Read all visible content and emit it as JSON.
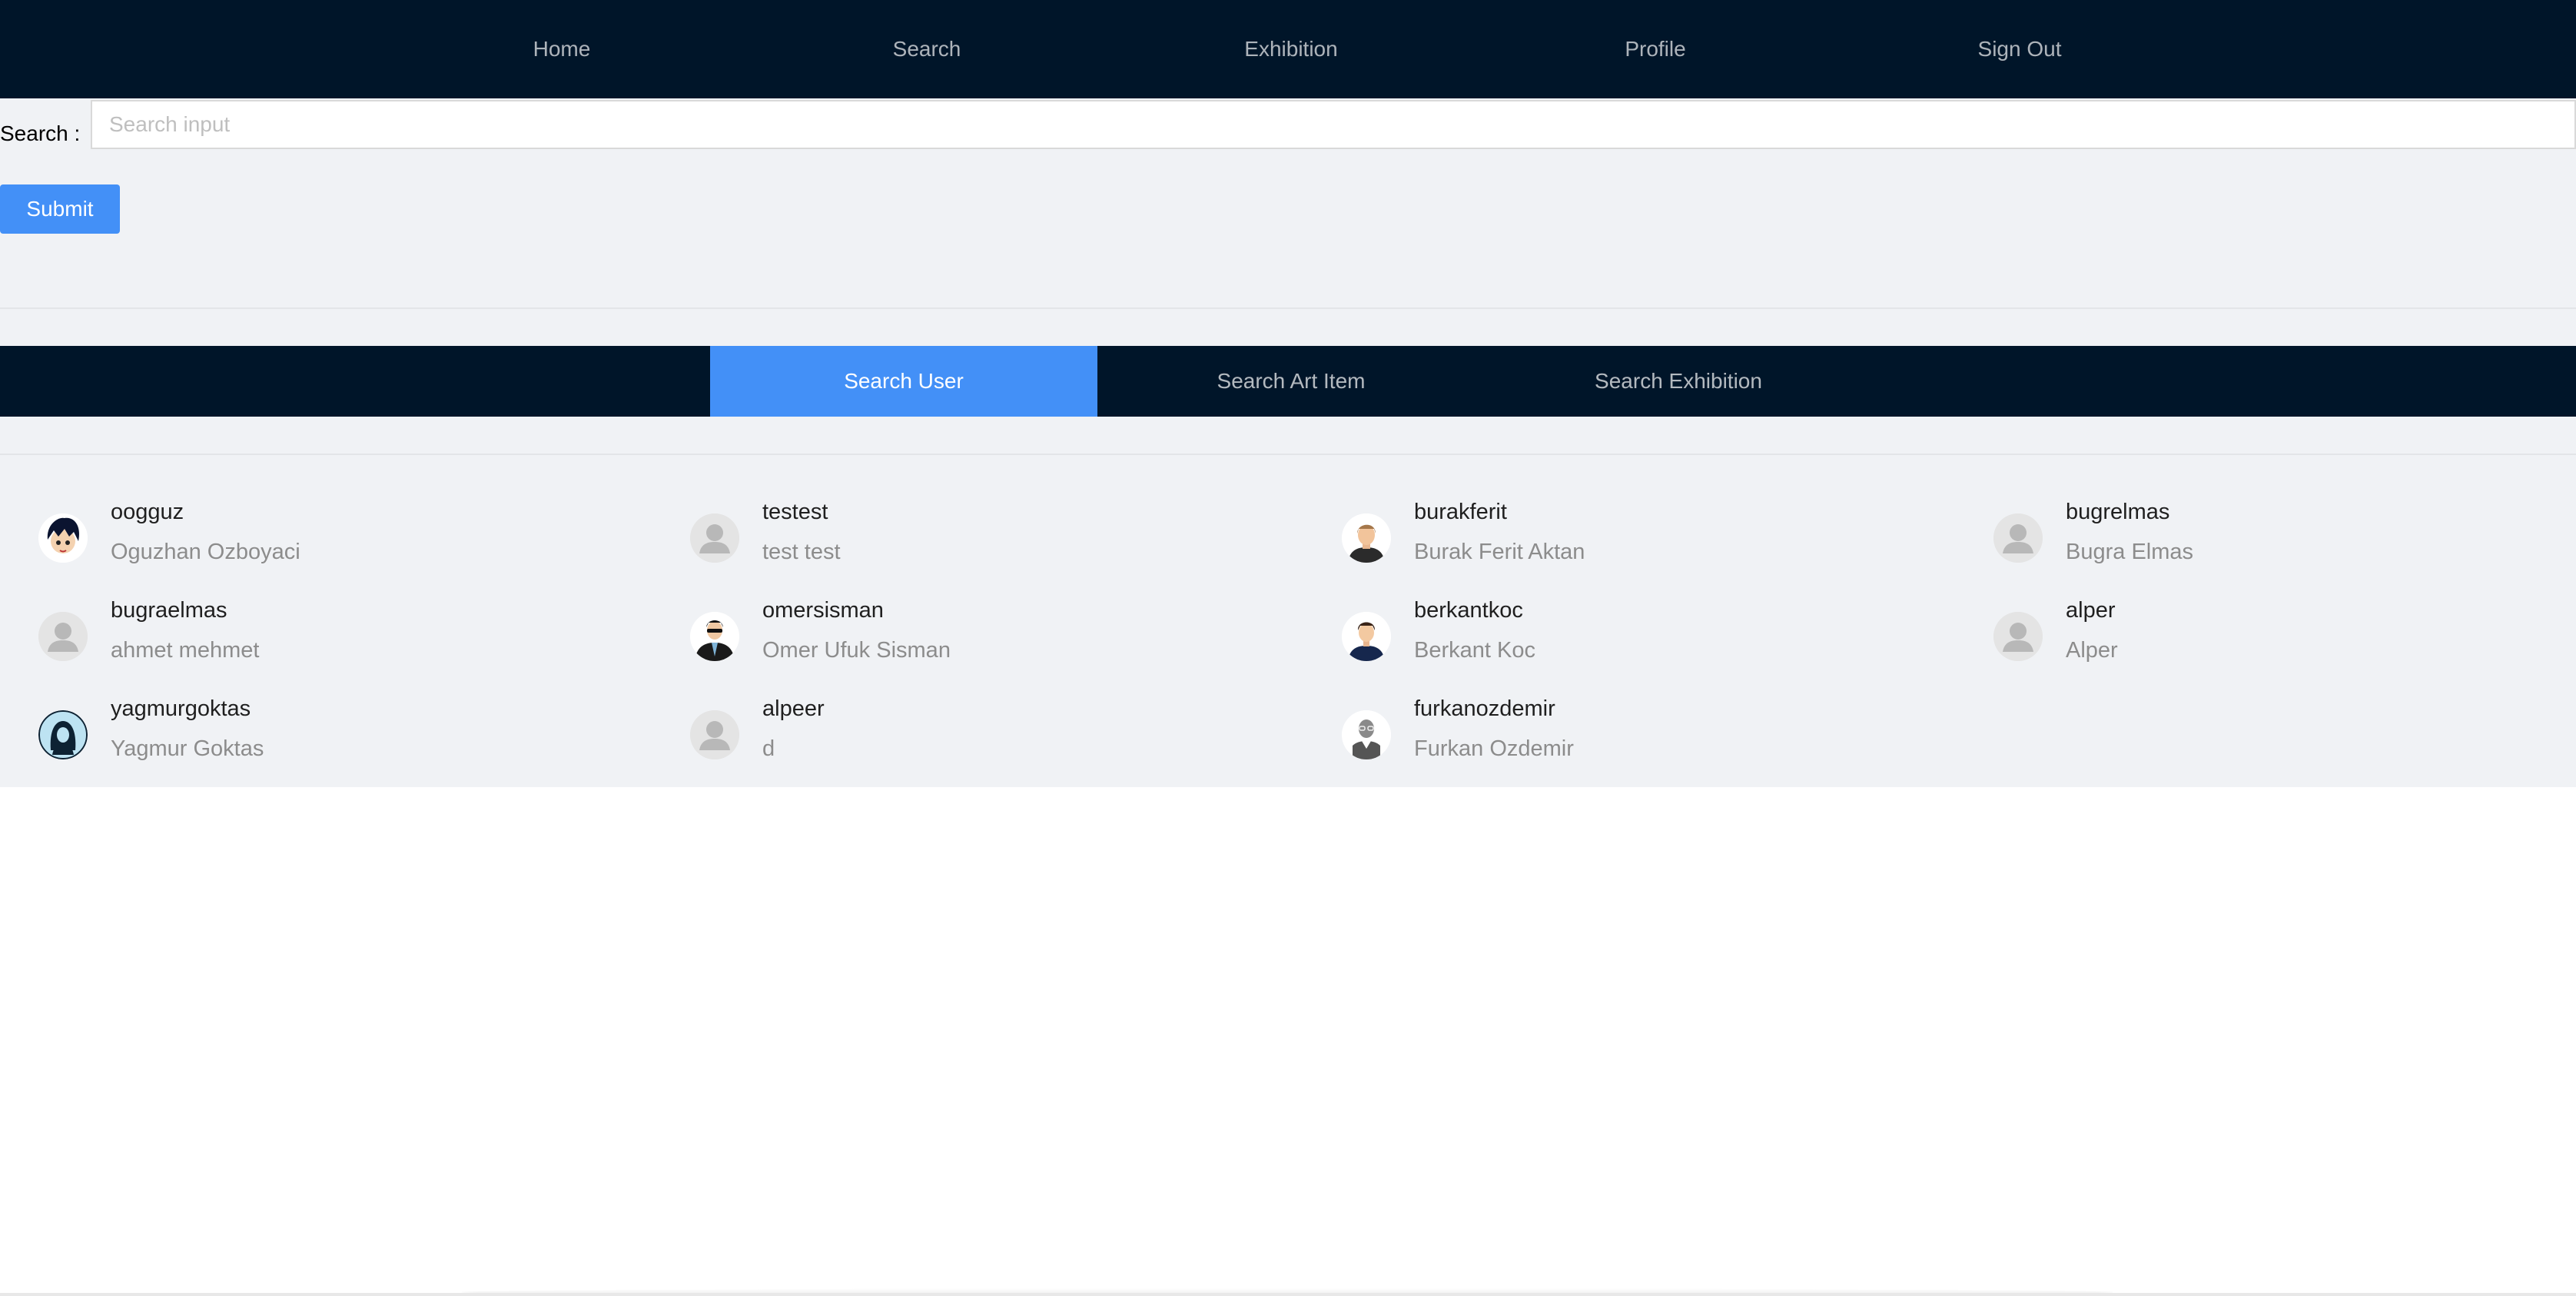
{
  "nav": {
    "items": [
      {
        "label": "Home"
      },
      {
        "label": "Search"
      },
      {
        "label": "Exhibition"
      },
      {
        "label": "Profile"
      },
      {
        "label": "Sign Out"
      }
    ]
  },
  "search": {
    "label": "Search :",
    "placeholder": "Search input",
    "value": "",
    "submit_label": "Submit"
  },
  "tabs": [
    {
      "label": "Search User",
      "active": true
    },
    {
      "label": "Search Art Item",
      "active": false
    },
    {
      "label": "Search Exhibition",
      "active": false
    }
  ],
  "users": [
    {
      "username": "oogguz",
      "name": "Oguzhan Ozboyaci",
      "avatar": "anime-boy-icon"
    },
    {
      "username": "testest",
      "name": "test test",
      "avatar": "default-user-icon"
    },
    {
      "username": "burakferit",
      "name": "Burak Ferit Aktan",
      "avatar": "man-avatar-icon"
    },
    {
      "username": "bugrelmas",
      "name": "Bugra Elmas",
      "avatar": "default-user-icon"
    },
    {
      "username": "bugraelmas",
      "name": "ahmet mehmet",
      "avatar": "default-user-icon"
    },
    {
      "username": "omersisman",
      "name": "Omer Ufuk Sisman",
      "avatar": "sunglasses-man-icon"
    },
    {
      "username": "berkantkoc",
      "name": "Berkant Koc",
      "avatar": "man-suit-icon"
    },
    {
      "username": "alper",
      "name": "Alper",
      "avatar": "default-user-icon"
    },
    {
      "username": "yagmurgoktas",
      "name": "Yagmur Goktas",
      "avatar": "woman-avatar-icon"
    },
    {
      "username": "alpeer",
      "name": "d",
      "avatar": "default-user-icon"
    },
    {
      "username": "furkanozdemir",
      "name": "Furkan Ozdemir",
      "avatar": "glasses-man-icon"
    }
  ],
  "colors": {
    "nav_bg": "#001529",
    "primary": "#4390f7",
    "content_bg": "#f0f2f5"
  }
}
